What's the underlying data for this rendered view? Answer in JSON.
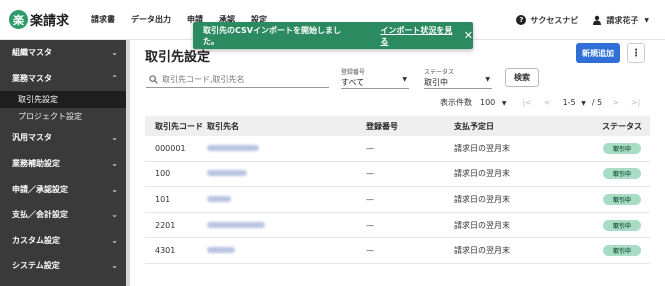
{
  "app": {
    "logo_mark": "楽",
    "logo_text": "楽請求"
  },
  "nav": {
    "items": [
      "請求書",
      "データ出力",
      "申請",
      "承認",
      "設定"
    ]
  },
  "header_right": {
    "help_label": "サクセスナビ",
    "user_name": "請求花子"
  },
  "toast": {
    "message": "取引先のCSVインポートを開始しました。",
    "link": "インポート状況を見る",
    "close": "✕"
  },
  "sidebar": {
    "groups": [
      {
        "label": "組織マスタ",
        "chevron": "⌄"
      },
      {
        "label": "業務マスタ",
        "chevron": "⌃"
      },
      {
        "label": "汎用マスタ",
        "chevron": "⌄"
      },
      {
        "label": "業務補助設定",
        "chevron": "⌄"
      },
      {
        "label": "申請／承認設定",
        "chevron": "⌄"
      },
      {
        "label": "支払／会計設定",
        "chevron": "⌄"
      },
      {
        "label": "カスタム設定",
        "chevron": "⌄"
      },
      {
        "label": "システム設定",
        "chevron": "⌄"
      }
    ],
    "sub_items": [
      "取引先設定",
      "プロジェクト設定"
    ]
  },
  "main": {
    "title": "取引先設定",
    "new_button": "新規追加",
    "more_button": "⋮",
    "search_placeholder": "取引先コード,取引先名",
    "filter_registration": {
      "label": "登録番号",
      "value": "すべて"
    },
    "filter_status": {
      "label": "ステータス",
      "value": "取引中"
    },
    "search_button": "検索",
    "pager": {
      "count_label": "表示件数",
      "count_value": "100",
      "range": "1-5",
      "total": "/ 5",
      "first": "|<",
      "prev": "<",
      "next": ">",
      "last": ">|"
    }
  },
  "table": {
    "headers": [
      "取引先コード",
      "取引先名",
      "登録番号",
      "支払予定日",
      "ステータス"
    ],
    "rows": [
      {
        "code": "000001",
        "reg": "—",
        "pay": "請求日の翌月末",
        "status": "取引中"
      },
      {
        "code": "100",
        "reg": "—",
        "pay": "請求日の翌月末",
        "status": "取引中"
      },
      {
        "code": "101",
        "reg": "—",
        "pay": "請求日の翌月末",
        "status": "取引中"
      },
      {
        "code": "2201",
        "reg": "—",
        "pay": "請求日の翌月末",
        "status": "取引中"
      },
      {
        "code": "4301",
        "reg": "—",
        "pay": "請求日の翌月末",
        "status": "取引中"
      }
    ]
  },
  "colors": {
    "brand": "#2e9b6c",
    "primary": "#2f6fd6",
    "sidebar": "#3a3a3a",
    "badge_bg": "#a9dcc4"
  }
}
